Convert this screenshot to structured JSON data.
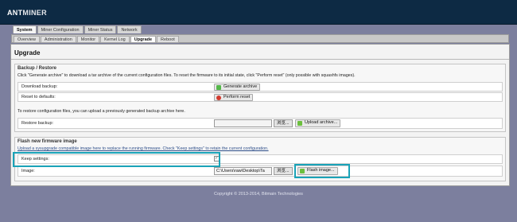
{
  "header": {
    "logo_main": "ANT",
    "logo_x": "MINER"
  },
  "top_tabs": [
    "System",
    "Miner Configuration",
    "Miner Status",
    "Network"
  ],
  "sub_tabs": [
    "Overview",
    "Administration",
    "Monitor",
    "Kernel Log",
    "Upgrade",
    "Reboot"
  ],
  "page": {
    "title": "Upgrade"
  },
  "backup": {
    "legend": "Backup / Restore",
    "desc": "Click \"Generate archive\" to download a tar archive of the current configuration files. To reset the firmware to its initial state, click \"Perform reset\" (only possible with squashfs images).",
    "download_label": "Download backup:",
    "generate_btn": "Generate archive",
    "reset_label": "Reset to defaults:",
    "reset_btn": "Perform reset",
    "restore_desc": "To restore configuration files, you can upload a previously generated backup archive here.",
    "restore_label": "Restore backup:",
    "restore_browse": "浏览...",
    "upload_btn": "Upload archive..."
  },
  "flash": {
    "legend": "Flash new firmware image",
    "desc": "Upload a sysupgrade compatible image here to replace the running firmware. Check \"Keep settings\" to retain the current configuration.",
    "keep_label": "Keep settings:",
    "keep_checked": true,
    "keep_mark": "✓",
    "image_label": "Image:",
    "image_value": "C:\\Users\\raw\\Desktop\\Ta",
    "image_browse": "浏览...",
    "flash_btn": "Flash image..."
  },
  "footer": {
    "text": "Copyright © 2013-2014, Bitmain Technologies"
  },
  "colors": {
    "header_bg": "#0d2a44",
    "page_bg": "#7c7f9e",
    "highlight": "#1aa3b8"
  },
  "icons": [
    "check-icon",
    "archive-icon",
    "reset-icon",
    "upload-icon",
    "flash-icon"
  ]
}
